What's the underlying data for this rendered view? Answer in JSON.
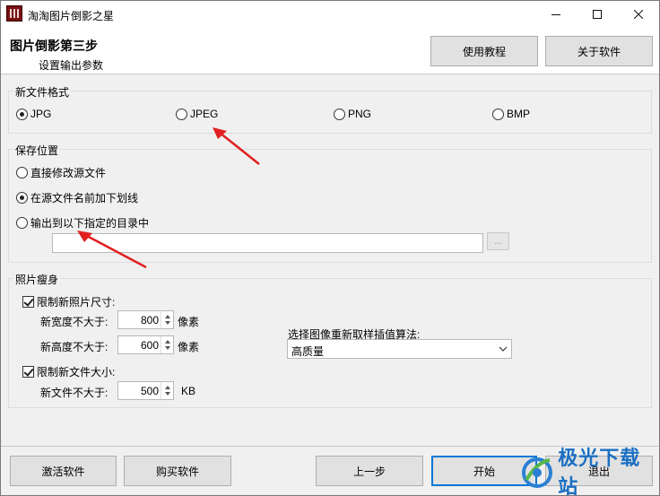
{
  "window": {
    "title": "淘淘图片倒影之星",
    "controls": {
      "minimize": "minimize-icon",
      "maximize": "maximize-icon",
      "close": "close-icon"
    }
  },
  "header": {
    "step_title": "图片倒影第三步",
    "step_subtitle": "设置输出参数",
    "tutorial_button": "使用教程",
    "about_button": "关于软件"
  },
  "format_group": {
    "label": "新文件格式",
    "options": [
      {
        "label": "JPG",
        "selected": true
      },
      {
        "label": "JPEG",
        "selected": false
      },
      {
        "label": "PNG",
        "selected": false
      },
      {
        "label": "BMP",
        "selected": false
      }
    ]
  },
  "location_group": {
    "label": "保存位置",
    "options": [
      {
        "label": "直接修改源文件",
        "selected": false
      },
      {
        "label": "在源文件名前加下划线",
        "selected": true
      },
      {
        "label": "输出到以下指定的目录中",
        "selected": false
      }
    ],
    "directory_value": "",
    "browse_label": "..."
  },
  "slim_group": {
    "label": "照片瘦身",
    "limit_size": {
      "label": "限制新照片尺寸:",
      "checked": true
    },
    "max_width": {
      "label": "新宽度不大于:",
      "value": "800",
      "unit": "像素"
    },
    "max_height": {
      "label": "新高度不大于:",
      "value": "600",
      "unit": "像素"
    },
    "limit_file": {
      "label": "限制新文件大小:",
      "checked": true
    },
    "max_file": {
      "label": "新文件不大于:",
      "value": "500",
      "unit": "KB"
    },
    "resample_label": "选择图像重新取样插值算法:",
    "resample_value": "高质量"
  },
  "footer": {
    "activate_button": "激活软件",
    "buy_button": "购买软件",
    "prev_button": "上一步",
    "start_button": "开始",
    "exit_button": "退出"
  },
  "watermark": {
    "text": "极光下载站"
  },
  "annotation_color": "#e02020"
}
